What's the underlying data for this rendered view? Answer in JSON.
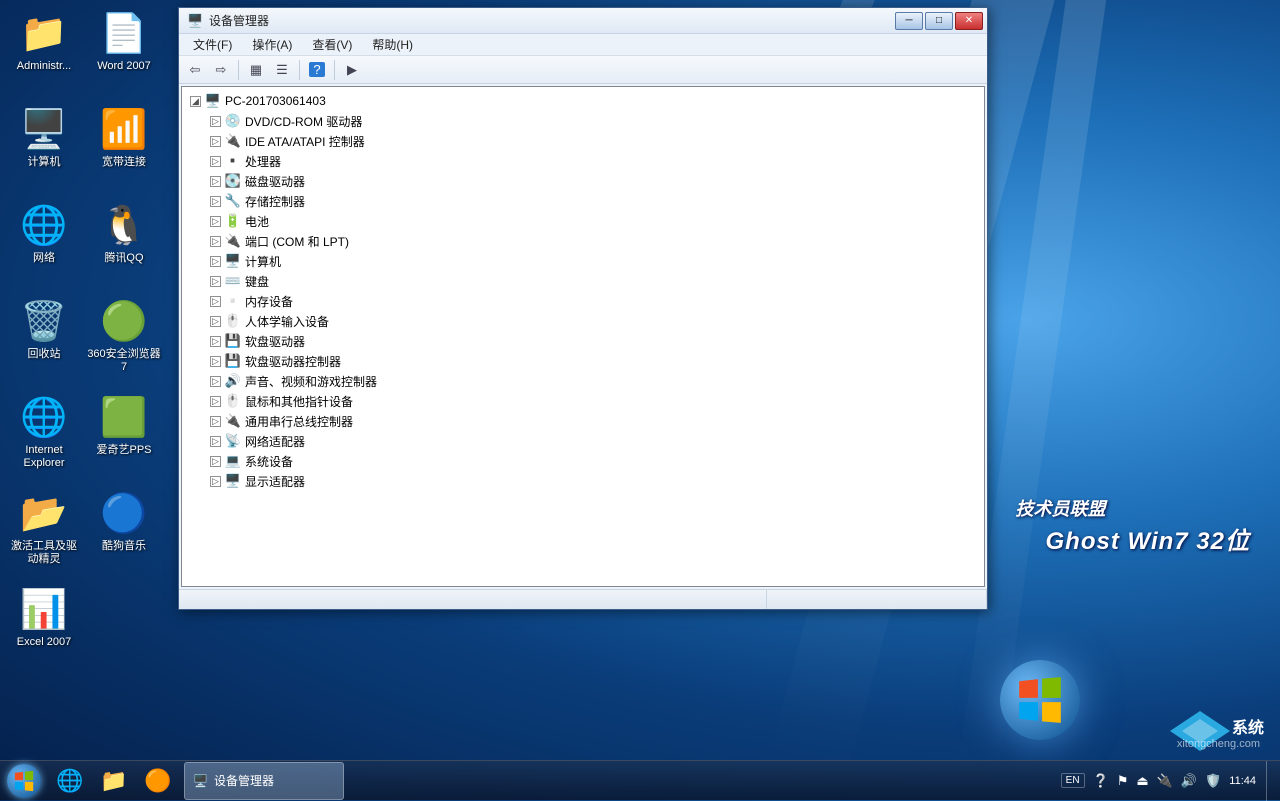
{
  "desktop_icons": [
    {
      "label": "Administr...",
      "glyph": "📁",
      "name": "folder-admin"
    },
    {
      "label": "计算机",
      "glyph": "🖥️",
      "name": "computer"
    },
    {
      "label": "网络",
      "glyph": "🌐",
      "name": "network"
    },
    {
      "label": "回收站",
      "glyph": "🗑️",
      "name": "recycle-bin"
    },
    {
      "label": "Internet Explorer",
      "glyph": "🌐",
      "name": "ie"
    },
    {
      "label": "激活工具及驱动精灵",
      "glyph": "📂",
      "name": "activation-tools"
    },
    {
      "label": "Excel 2007",
      "glyph": "📊",
      "name": "excel"
    },
    {
      "label": "Word 2007",
      "glyph": "📄",
      "name": "word"
    },
    {
      "label": "宽带连接",
      "glyph": "📶",
      "name": "broadband"
    },
    {
      "label": "腾讯QQ",
      "glyph": "🐧",
      "name": "qq"
    },
    {
      "label": "360安全浏览器7",
      "glyph": "🟢",
      "name": "360browser"
    },
    {
      "label": "爱奇艺PPS",
      "glyph": "🟩",
      "name": "iqiyi"
    },
    {
      "label": "酷狗音乐",
      "glyph": "🔵",
      "name": "kugou"
    }
  ],
  "brand": {
    "line1": "技术员联盟",
    "line2": "Ghost Win7 32位"
  },
  "watermark": "xitongcheng.com",
  "window": {
    "title": "设备管理器",
    "menus": [
      "文件(F)",
      "操作(A)",
      "查看(V)",
      "帮助(H)"
    ],
    "root": "PC-201703061403",
    "nodes": [
      {
        "label": "DVD/CD-ROM 驱动器",
        "icon": "💿"
      },
      {
        "label": "IDE ATA/ATAPI 控制器",
        "icon": "🔌"
      },
      {
        "label": "处理器",
        "icon": "▪️"
      },
      {
        "label": "磁盘驱动器",
        "icon": "💽"
      },
      {
        "label": "存储控制器",
        "icon": "🔧"
      },
      {
        "label": "电池",
        "icon": "🔋"
      },
      {
        "label": "端口 (COM 和 LPT)",
        "icon": "🔌"
      },
      {
        "label": "计算机",
        "icon": "🖥️"
      },
      {
        "label": "键盘",
        "icon": "⌨️"
      },
      {
        "label": "内存设备",
        "icon": "▫️"
      },
      {
        "label": "人体学输入设备",
        "icon": "🖱️"
      },
      {
        "label": "软盘驱动器",
        "icon": "💾"
      },
      {
        "label": "软盘驱动器控制器",
        "icon": "💾"
      },
      {
        "label": "声音、视频和游戏控制器",
        "icon": "🔊"
      },
      {
        "label": "鼠标和其他指针设备",
        "icon": "🖱️"
      },
      {
        "label": "通用串行总线控制器",
        "icon": "🔌"
      },
      {
        "label": "网络适配器",
        "icon": "📡"
      },
      {
        "label": "系统设备",
        "icon": "💻"
      },
      {
        "label": "显示适配器",
        "icon": "🖥️"
      }
    ]
  },
  "taskbar": {
    "active_task": "设备管理器",
    "lang": "EN",
    "time": "11:44"
  }
}
